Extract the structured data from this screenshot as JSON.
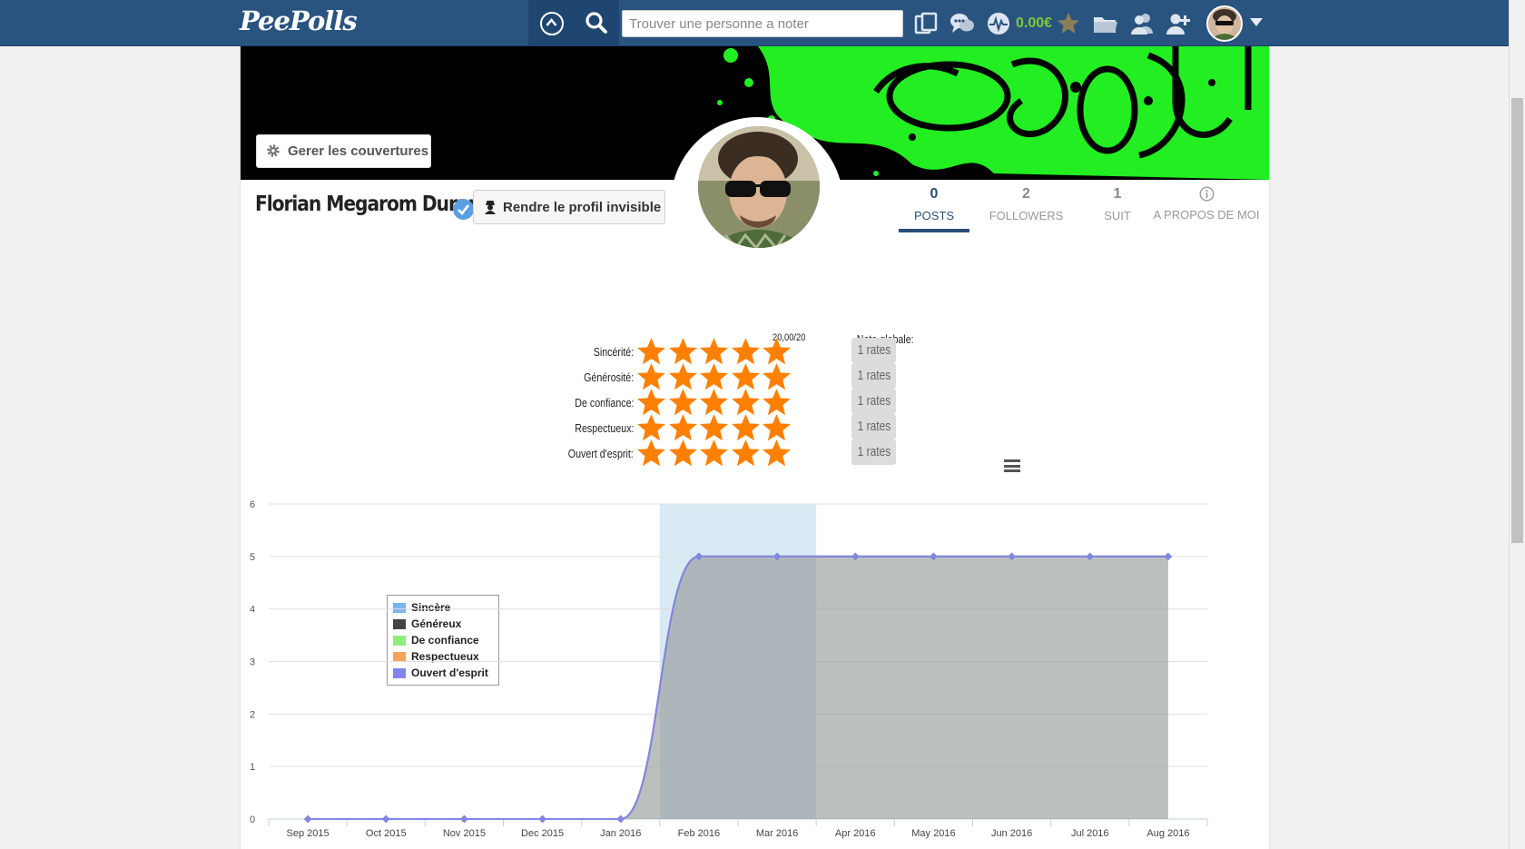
{
  "navbar": {
    "logo": "PeePolls",
    "search_placeholder": "Trouver une personne a noter",
    "balance": "0.00€"
  },
  "cover": {
    "manage_button": "Gerer les couvertures"
  },
  "profile": {
    "name": "Florian Megarom Durano",
    "invisible_button": "Rendre le profil invisible",
    "tabs": [
      {
        "num": "0",
        "label": "POSTS"
      },
      {
        "num": "2",
        "label": "FOLLOWERS"
      },
      {
        "num": "1",
        "label": "SUIT"
      },
      {
        "label": "A PROPOS DE MOI"
      }
    ]
  },
  "ratings": {
    "global_label": "Note globale:",
    "global_value": "20,00/20",
    "rows": [
      {
        "label": "Sincérité:",
        "stars": 5,
        "rates": "1 rates"
      },
      {
        "label": "Générosité:",
        "stars": 5,
        "rates": "1 rates"
      },
      {
        "label": "De confiance:",
        "stars": 5,
        "rates": "1 rates"
      },
      {
        "label": "Respectueux:",
        "stars": 5,
        "rates": "1 rates"
      },
      {
        "label": "Ouvert d'esprit:",
        "stars": 5,
        "rates": "1 rates"
      }
    ],
    "star_color": "#ff8000"
  },
  "chart_data": {
    "type": "area",
    "categories": [
      "Sep 2015",
      "Oct 2015",
      "Nov 2015",
      "Dec 2015",
      "Jan 2016",
      "Feb 2016",
      "Mar 2016",
      "Apr 2016",
      "May 2016",
      "Jun 2016",
      "Jul 2016",
      "Aug 2016"
    ],
    "series": [
      {
        "name": "Sincère",
        "color": "#7cb5ec",
        "values": [
          0,
          0,
          0,
          0,
          0,
          5,
          5,
          5,
          5,
          5,
          5,
          5
        ]
      },
      {
        "name": "Généreux",
        "color": "#434348",
        "values": [
          0,
          0,
          0,
          0,
          0,
          5,
          5,
          5,
          5,
          5,
          5,
          5
        ]
      },
      {
        "name": "De confiance",
        "color": "#90ed7d",
        "values": [
          0,
          0,
          0,
          0,
          0,
          5,
          5,
          5,
          5,
          5,
          5,
          5
        ]
      },
      {
        "name": "Respectueux",
        "color": "#f7a35c",
        "values": [
          0,
          0,
          0,
          0,
          0,
          5,
          5,
          5,
          5,
          5,
          5,
          5
        ]
      },
      {
        "name": "Ouvert d'esprit",
        "color": "#8085e9",
        "values": [
          0,
          0,
          0,
          0,
          0,
          5,
          5,
          5,
          5,
          5,
          5,
          5
        ]
      }
    ],
    "y_ticks": [
      0,
      1,
      2,
      3,
      4,
      5,
      6
    ],
    "ylim": [
      0,
      6
    ],
    "highlighted_category": "Feb 2016",
    "grid": true
  }
}
